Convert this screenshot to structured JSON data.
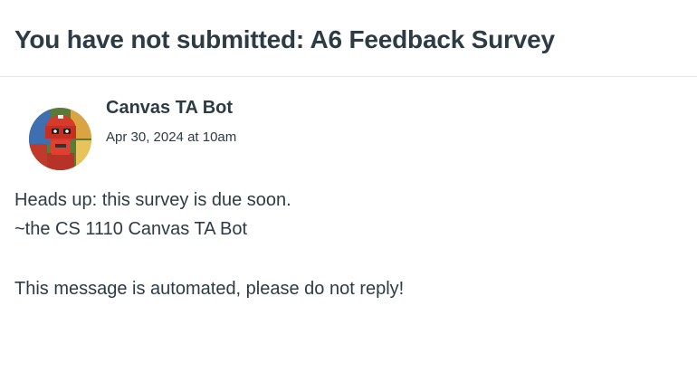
{
  "header": {
    "title": "You have not submitted: A6 Feedback Survey"
  },
  "message": {
    "author": "Canvas TA Bot",
    "timestamp": "Apr 30, 2024 at 10am",
    "avatar_icon": "robot-avatar-icon",
    "lines": [
      "Heads up: this survey is due soon.",
      "~the CS 1110 Canvas TA Bot",
      "This message is automated, please do not reply!"
    ]
  },
  "colors": {
    "text": "#2d3b45",
    "divider": "#e4e7e9",
    "background": "#ffffff"
  }
}
